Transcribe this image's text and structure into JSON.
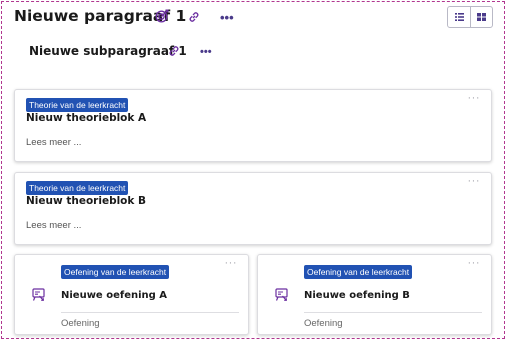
{
  "paragraph": {
    "title": "Nieuwe paragraaf 1",
    "more": "•••",
    "icons": [
      "target-icon",
      "link-icon"
    ]
  },
  "view_toggle": {
    "icons": [
      "list-view-icon",
      "grid-view-icon"
    ]
  },
  "subparagraph": {
    "title": "Nieuwe subparagraaf 1",
    "more": "•••"
  },
  "theory_blocks": [
    {
      "badge": "Theorie van de leerkracht",
      "title": "Nieuw theorieblok A",
      "read_more": "Lees meer ...",
      "more": "···"
    },
    {
      "badge": "Theorie van de leerkracht",
      "title": "Nieuw theorieblok B",
      "read_more": "Lees meer ...",
      "more": "···"
    }
  ],
  "exercises": [
    {
      "badge": "Oefening van de leerkracht",
      "title": "Nieuwe oefening A",
      "type": "Oefening",
      "more": "···",
      "icon": "exercise-icon"
    },
    {
      "badge": "Oefening van de leerkracht",
      "title": "Nieuwe oefening B",
      "type": "Oefening",
      "more": "···",
      "icon": "exercise-icon"
    }
  ],
  "colors": {
    "badge": "#2152b3",
    "accent": "#6b2fa0",
    "frame_border": "#b0368f"
  }
}
